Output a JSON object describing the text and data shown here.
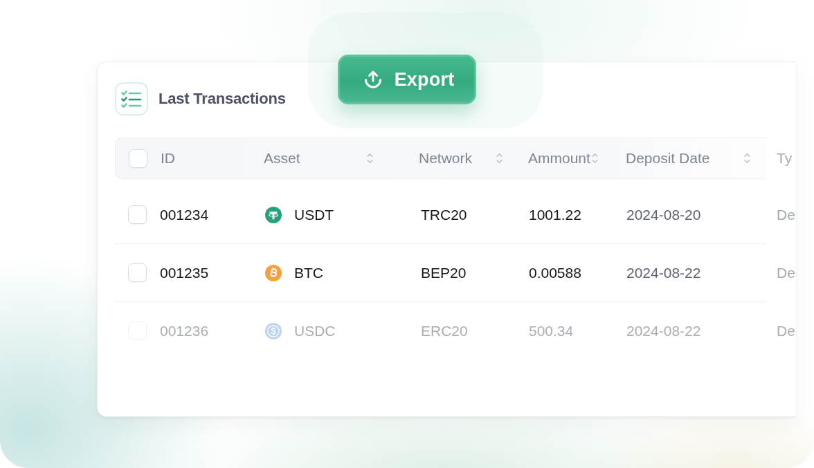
{
  "card": {
    "title": "Last Transactions",
    "export_button": {
      "label": "Export"
    },
    "table": {
      "select_all": {
        "checked": false
      },
      "columns": [
        {
          "label": "ID",
          "sortable": false
        },
        {
          "label": "Asset",
          "sortable": true
        },
        {
          "label": "Network",
          "sortable": true
        },
        {
          "label": "Ammount",
          "sortable": true
        },
        {
          "label": "Deposit Date",
          "sortable": true
        },
        {
          "label": "Ty",
          "sortable": false
        }
      ],
      "rows": [
        {
          "checked": false,
          "dimmed": false,
          "id": "001234",
          "asset": {
            "label": "USDT",
            "kind": "tee"
          },
          "network": "TRC20",
          "amount": "1001.22",
          "deposit_date": "2024-08-20",
          "column_6": "De"
        },
        {
          "checked": false,
          "dimmed": false,
          "id": "001235",
          "asset": {
            "label": "BTC",
            "kind": "bitcoin"
          },
          "network": "BEP20",
          "amount": "0.00588",
          "deposit_date": "2024-08-22",
          "column_6": "De"
        },
        {
          "checked": false,
          "dimmed": true,
          "id": "001236",
          "asset": {
            "label": "USDC",
            "kind": "dollar"
          },
          "network": "ERC20",
          "amount": "500.34",
          "deposit_date": "2024-08-22",
          "column_6": "De"
        }
      ]
    }
  }
}
